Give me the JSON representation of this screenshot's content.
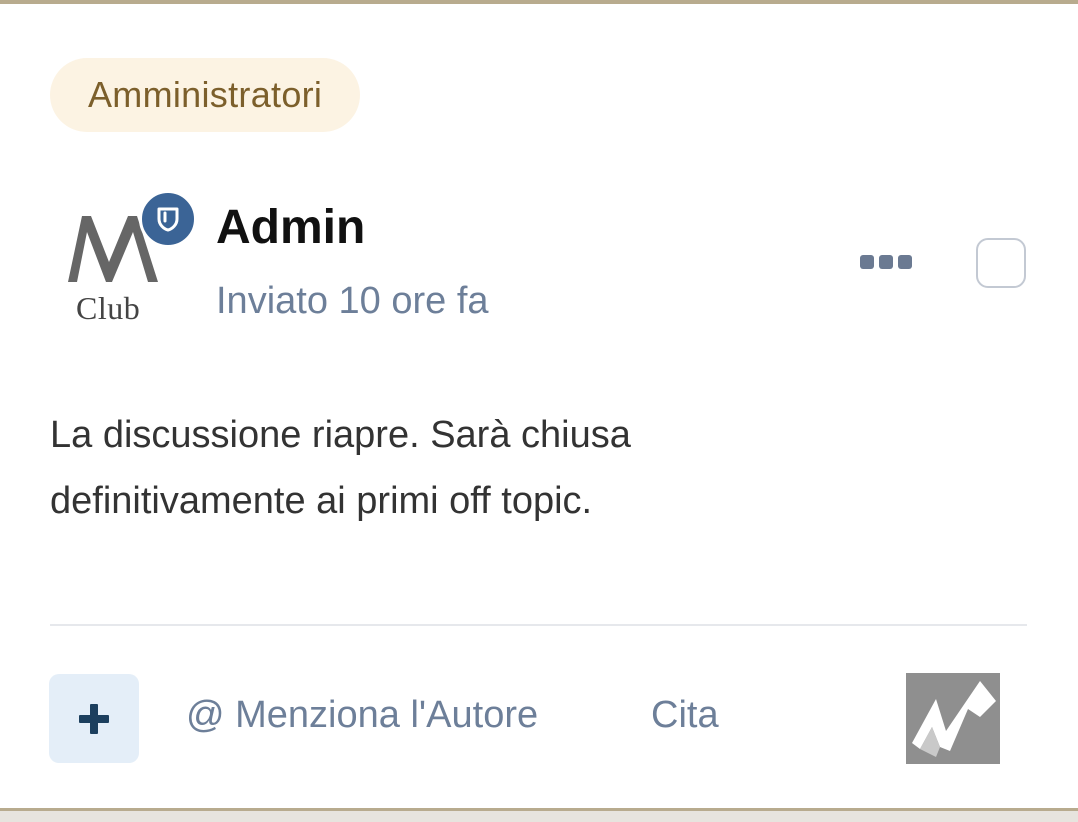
{
  "post": {
    "group_badge": "Amministratori",
    "avatar": {
      "logo_text": "Club",
      "badge_icon": "shield-icon"
    },
    "author": "Admin",
    "time": "Inviato 10 ore fa",
    "body": "La discussione riapre. Sarà chiusa definitivamente ai primi off topic."
  },
  "actions": {
    "more_icon": "ellipsis-icon",
    "add_icon": "plus-icon",
    "mention_label": "@ Menziona l'Autore",
    "quote_label": "Cita"
  },
  "colors": {
    "accent": "#3b6496",
    "badge_bg": "#fcf3e3",
    "badge_text": "#7c5f2b",
    "meta_text": "#6d7f99",
    "add_button_bg": "#e4eef8",
    "add_icon": "#1c3f5e"
  }
}
